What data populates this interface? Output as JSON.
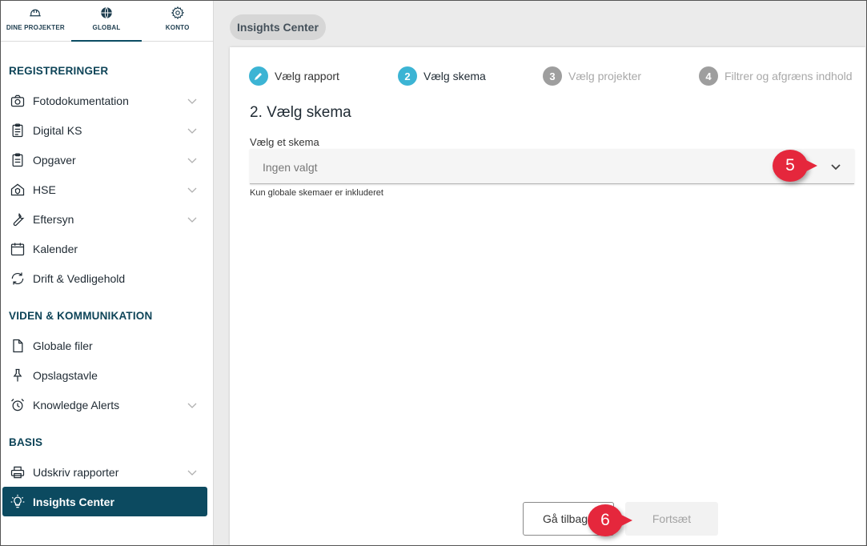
{
  "topnav": {
    "tabs": [
      {
        "label": "DINE PROJEKTER",
        "icon": "helmet-icon"
      },
      {
        "label": "GLOBAL",
        "icon": "globe-icon",
        "active": true
      },
      {
        "label": "KONTO",
        "icon": "gear-icon"
      }
    ]
  },
  "sidebar": {
    "sections": [
      {
        "title": "REGISTRERINGER"
      },
      {
        "title": "VIDEN & KOMMUNIKATION"
      },
      {
        "title": "BASIS"
      }
    ],
    "items": [
      {
        "label": "Fotodokumentation",
        "icon": "camera-icon",
        "expandable": true
      },
      {
        "label": "Digital KS",
        "icon": "clipboard-check-icon",
        "expandable": true
      },
      {
        "label": "Opgaver",
        "icon": "clipboard-list-icon",
        "expandable": true
      },
      {
        "label": "HSE",
        "icon": "house-shield-icon",
        "expandable": true
      },
      {
        "label": "Eftersyn",
        "icon": "wrench-icon",
        "expandable": true
      },
      {
        "label": "Kalender",
        "icon": "calendar-icon",
        "expandable": false
      },
      {
        "label": "Drift & Vedligehold",
        "icon": "sync-icon",
        "expandable": false
      },
      {
        "label": "Globale filer",
        "icon": "file-icon",
        "expandable": false
      },
      {
        "label": "Opslagstavle",
        "icon": "pin-icon",
        "expandable": false
      },
      {
        "label": "Knowledge Alerts",
        "icon": "alarm-clock-icon",
        "expandable": true
      },
      {
        "label": "Udskriv rapporter",
        "icon": "printer-icon",
        "expandable": true
      },
      {
        "label": "Insights Center",
        "icon": "lightbulb-icon",
        "expandable": false,
        "active": true
      }
    ]
  },
  "breadcrumb": "Insights Center",
  "steps": [
    {
      "number": "",
      "label": "Vælg rapport",
      "state": "done"
    },
    {
      "number": "2",
      "label": "Vælg skema",
      "state": "active"
    },
    {
      "number": "3",
      "label": "Vælg projekter",
      "state": "pending"
    },
    {
      "number": "4",
      "label": "Filtrer og afgræns indhold",
      "state": "pending"
    }
  ],
  "form": {
    "heading": "2. Vælg skema",
    "field_label": "Vælg et skema",
    "select_value": "Ingen valgt",
    "hint": "Kun globale skemaer er inkluderet"
  },
  "buttons": {
    "back": "Gå tilbage",
    "next": "Fortsæt"
  },
  "markers": [
    "5",
    "6"
  ],
  "colors": {
    "accent": "#0c4a60",
    "step_active": "#3cb4d4",
    "step_pending": "#9e9e9e",
    "marker": "#e5273c"
  }
}
